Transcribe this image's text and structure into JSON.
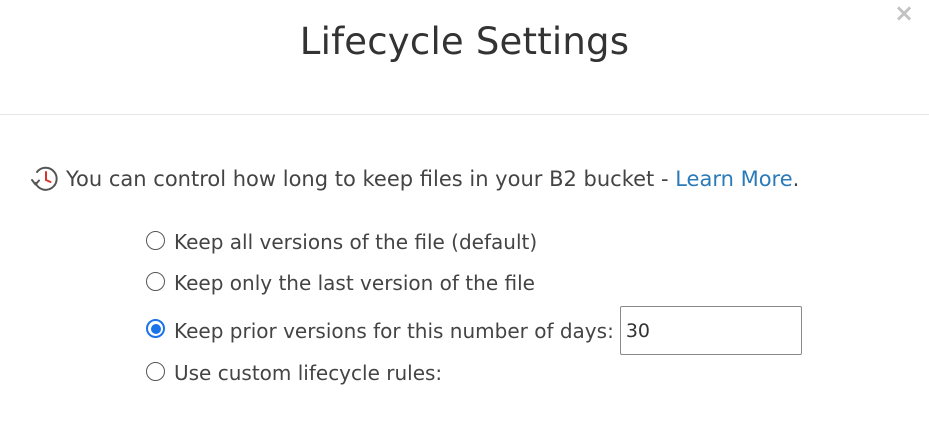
{
  "dialog": {
    "title": "Lifecycle Settings",
    "close_glyph": "×"
  },
  "info": {
    "icon": "history-clock-icon",
    "text": "You can control how long to keep files in your B2 bucket - ",
    "link_text": "Learn More",
    "trailing": "."
  },
  "options": [
    {
      "label": "Keep all versions of the file (default)",
      "selected": false
    },
    {
      "label": "Keep only the last version of the file",
      "selected": false
    },
    {
      "label": "Keep prior versions for this number of days:",
      "selected": true
    },
    {
      "label": "Use custom lifecycle rules:",
      "selected": false
    }
  ],
  "days_input": {
    "value": "30"
  },
  "colors": {
    "accent": "#1a73e8",
    "link": "#2b7bb9",
    "close": "#c2c2c2"
  }
}
